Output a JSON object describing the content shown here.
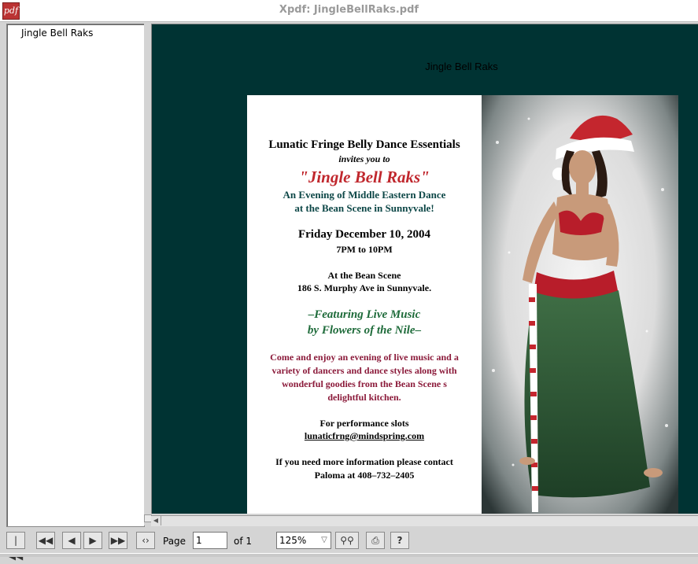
{
  "window": {
    "title": "Xpdf: JingleBellRaks.pdf"
  },
  "outline": {
    "items": [
      "Jingle Bell Raks"
    ]
  },
  "document": {
    "page_heading": "Jingle Bell Raks",
    "lines": [
      "Lunatic Fringe Belly Dance Essentials",
      "invites you to",
      "\"Jingle Bell Raks\"",
      "An Evening of Middle Eastern Dance",
      "at the Bean Scene in Sunnyvale!",
      "Friday December 10, 2004",
      "7PM to 10PM",
      "At the Bean Scene",
      "186 S. Murphy Ave in Sunnyvale.",
      "–Featuring Live Music",
      "by Flowers of the Nile–",
      "Come and enjoy an evening of live music and a",
      "variety of dancers and dance styles along with",
      "wonderful goodies from the Bean Scene  s",
      "delightful kitchen.",
      "For performance slots",
      "lunaticfrng@mindspring.com",
      "If you need more information please contact",
      "Paloma at 408–732–2405"
    ]
  },
  "colors": {
    "viewer_bg": "#003333",
    "red": "#c0272d",
    "teal": "#0d4747",
    "green": "#1e6b3a",
    "maroon": "#8b1a3a"
  },
  "toolbar": {
    "page_label": "Page",
    "page_value": "1",
    "of_label": "of 1",
    "zoom_value": "125%",
    "help_label": "?"
  },
  "icons": {
    "first_page": "first-page-icon",
    "prev_10": "back-10-pages-icon",
    "prev": "previous-page-icon",
    "next": "next-page-icon",
    "next_10": "forward-10-pages-icon",
    "history": "history-back-forward-icon",
    "find": "find-binoculars-icon",
    "print": "print-icon"
  }
}
